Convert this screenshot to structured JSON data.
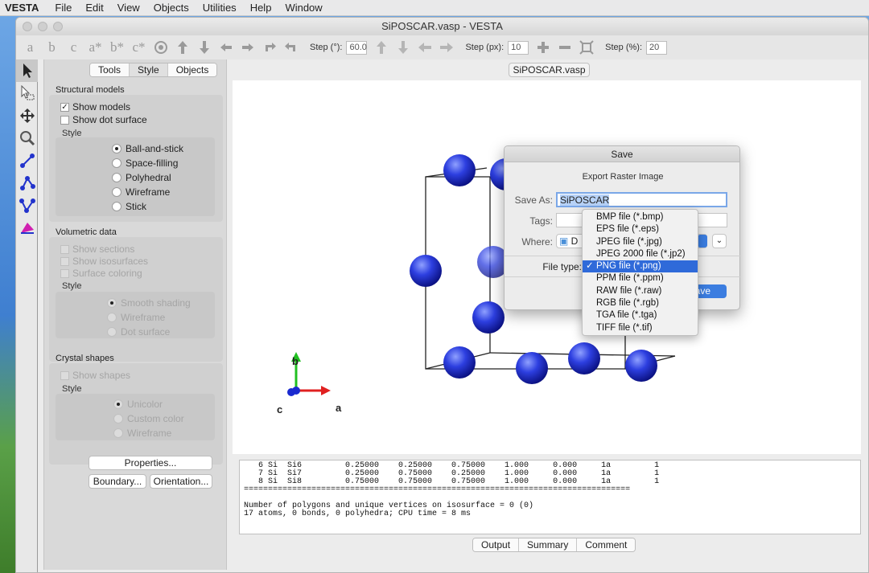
{
  "menubar": {
    "app": "VESTA",
    "items": [
      "File",
      "Edit",
      "View",
      "Objects",
      "Utilities",
      "Help",
      "Window"
    ]
  },
  "window": {
    "title": "SiPOSCAR.vasp - VESTA"
  },
  "toolbar": {
    "step_deg_label": "Step (°):",
    "step_deg_value": "60.0",
    "step_px_label": "Step (px):",
    "step_px_value": "10",
    "step_pct_label": "Step (%):",
    "step_pct_value": "20",
    "axis_glyphs": [
      "a",
      "b",
      "c",
      "a*",
      "b*",
      "c*"
    ]
  },
  "side_tabs": [
    "Tools",
    "Style",
    "Objects"
  ],
  "structural": {
    "title": "Structural models",
    "show_models": "Show models",
    "show_dot_surface": "Show dot surface",
    "style_label": "Style",
    "styles": [
      "Ball-and-stick",
      "Space-filling",
      "Polyhedral",
      "Wireframe",
      "Stick"
    ]
  },
  "volumetric": {
    "title": "Volumetric data",
    "options": [
      "Show sections",
      "Show isosurfaces",
      "Surface coloring"
    ],
    "style_label": "Style",
    "styles": [
      "Smooth shading",
      "Wireframe",
      "Dot surface"
    ]
  },
  "crystal": {
    "title": "Crystal shapes",
    "show_shapes": "Show shapes",
    "style_label": "Style",
    "styles": [
      "Unicolor",
      "Custom color",
      "Wireframe"
    ]
  },
  "panel_buttons": {
    "properties": "Properties...",
    "boundary": "Boundary...",
    "orientation": "Orientation..."
  },
  "doc_tab": "SiPOSCAR.vasp",
  "axes": {
    "a": "a",
    "b": "b",
    "c": "c"
  },
  "output": {
    "lines": [
      "   6 Si  Si6         0.25000    0.25000    0.75000    1.000     0.000     1a         1",
      "   7 Si  Si7         0.25000    0.75000    0.25000    1.000     0.000     1a         1",
      "   8 Si  Si8         0.75000    0.75000    0.75000    1.000     0.000     1a         1",
      "================================================================================",
      "",
      "Number of polygons and unique vertices on isosurface = 0 (0)",
      "17 atoms, 0 bonds, 0 polyhedra; CPU time = 8 ms"
    ],
    "tabs": [
      "Output",
      "Summary",
      "Comment"
    ]
  },
  "save_dialog": {
    "title": "Save",
    "subtitle": "Export Raster Image",
    "save_as_label": "Save As:",
    "save_as_value": "SiPOSCAR",
    "tags_label": "Tags:",
    "where_label": "Where:",
    "where_value": "D",
    "file_type_label": "File type:",
    "save_button": "ave"
  },
  "file_types": {
    "selected_index": 4,
    "options": [
      "BMP file (*.bmp)",
      "EPS file (*.eps)",
      "JPEG file (*.jpg)",
      "JPEG 2000 file (*.jp2)",
      "PNG file (*.png)",
      "PPM file (*.ppm)",
      "RAW file (*.raw)",
      "RGB file (*.rgb)",
      "TGA file (*.tga)",
      "TIFF file (*.tif)"
    ]
  },
  "colors": {
    "atom": "#2233cc",
    "selection": "#2f6ad9",
    "axis_a": "#e02020",
    "axis_b": "#20c020",
    "axis_c": "#1a2ad0"
  }
}
